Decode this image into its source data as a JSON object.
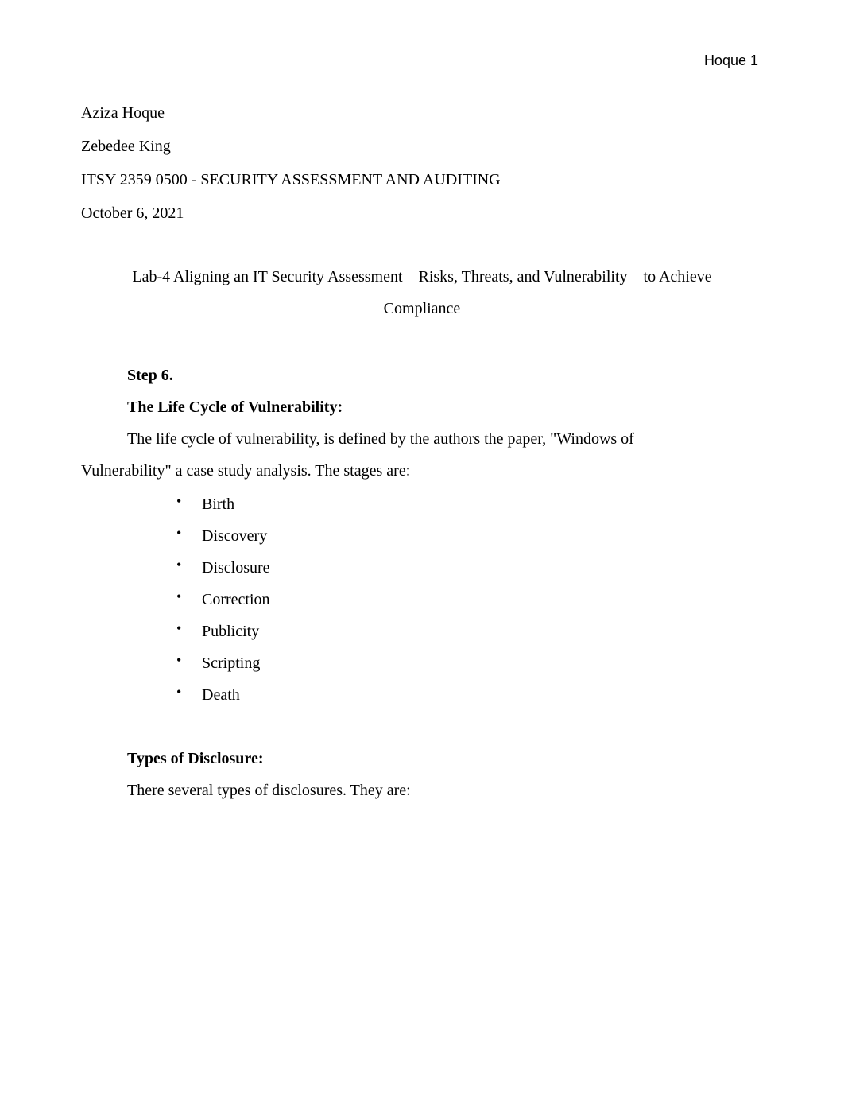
{
  "running_head": "Hoque 1",
  "meta": {
    "author": "Aziza Hoque",
    "instructor": "Zebedee King",
    "course": "ITSY 2359 0500 - SECURITY ASSESSMENT AND AUDITING",
    "date": "October 6, 2021"
  },
  "title": {
    "line1": "Lab-4 Aligning an IT Security Assessment—Risks, Threats, and Vulnerability—to Achieve",
    "line2": "Compliance"
  },
  "step_heading": "Step 6.",
  "lifecycle": {
    "heading": "The Life Cycle of Vulnerability:",
    "para_line1": "The life cycle of vulnerability, is defined by the authors the paper, \"Windows of",
    "para_line2": "Vulnerability\" a case study analysis. The stages are:",
    "items": [
      "Birth",
      "Discovery",
      "Disclosure",
      "Correction",
      "Publicity",
      "Scripting",
      "Death"
    ]
  },
  "disclosure": {
    "heading": "Types of Disclosure:",
    "para": "There several types of disclosures. They are:"
  }
}
